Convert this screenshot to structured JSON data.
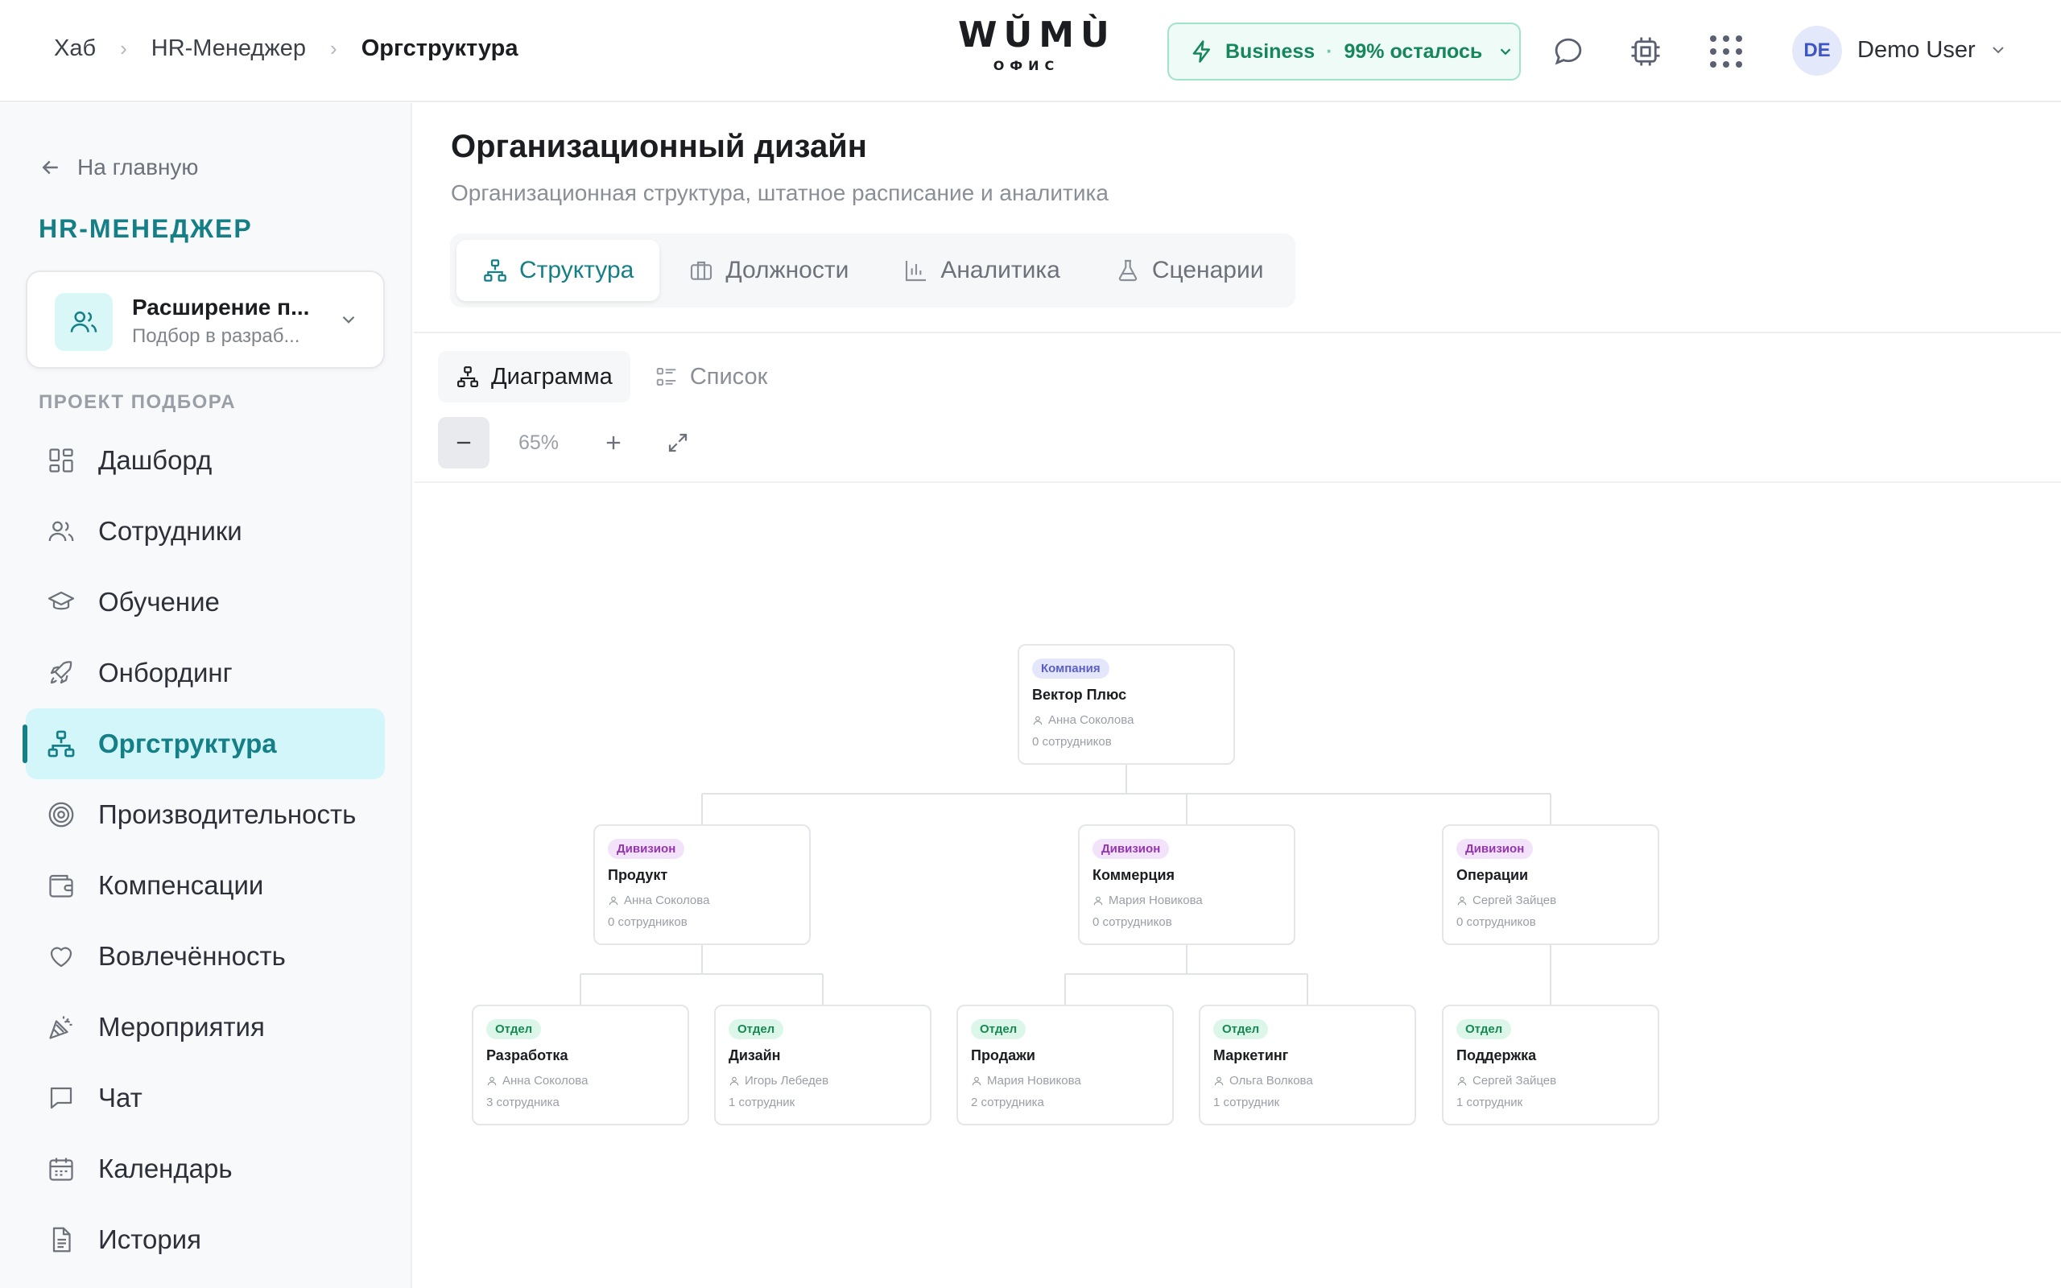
{
  "breadcrumbs": [
    "Хаб",
    "HR-Менеджер",
    "Оргструктура"
  ],
  "logo": {
    "main": "WŬMÙ",
    "sub": "ОФИС"
  },
  "plan": {
    "name": "Business",
    "separator": "·",
    "remaining": "99% осталось"
  },
  "user": {
    "initials": "DE",
    "name": "Demo User"
  },
  "sidebar": {
    "back": "На главную",
    "title": "HR-МЕНЕДЖЕР",
    "project": {
      "title": "Расширение п...",
      "subtitle": "Подбор в разраб..."
    },
    "section": "ПРОЕКТ ПОДБОРА",
    "items": [
      {
        "label": "Дашборд",
        "icon": "dashboard-icon"
      },
      {
        "label": "Сотрудники",
        "icon": "users-icon"
      },
      {
        "label": "Обучение",
        "icon": "graduation-cap-icon"
      },
      {
        "label": "Онбординг",
        "icon": "rocket-icon"
      },
      {
        "label": "Оргструктура",
        "icon": "org-chart-icon",
        "active": true
      },
      {
        "label": "Производительность",
        "icon": "target-icon"
      },
      {
        "label": "Компенсации",
        "icon": "wallet-icon"
      },
      {
        "label": "Вовлечённость",
        "icon": "heart-icon"
      },
      {
        "label": "Мероприятия",
        "icon": "party-icon"
      },
      {
        "label": "Чат",
        "icon": "chat-icon"
      },
      {
        "label": "Календарь",
        "icon": "calendar-icon"
      },
      {
        "label": "История",
        "icon": "document-icon"
      }
    ]
  },
  "main": {
    "title": "Организационный дизайн",
    "subtitle": "Организационная структура, штатное расписание и аналитика",
    "tabs": [
      {
        "label": "Структура",
        "icon": "org-chart-icon",
        "active": true
      },
      {
        "label": "Должности",
        "icon": "briefcase-icon"
      },
      {
        "label": "Аналитика",
        "icon": "bar-chart-icon"
      },
      {
        "label": "Сценарии",
        "icon": "flask-icon"
      }
    ],
    "view_tabs": [
      {
        "label": "Диаграмма",
        "icon": "org-chart-icon",
        "active": true
      },
      {
        "label": "Список",
        "icon": "list-icon"
      }
    ],
    "zoom": "65%"
  },
  "org": {
    "root": {
      "badge": "Компания",
      "name": "Вектор Плюс",
      "lead": "Анна Соколова",
      "count": "0 сотрудников"
    },
    "divisions": [
      {
        "badge": "Дивизион",
        "name": "Продукт",
        "lead": "Анна Соколова",
        "count": "0 сотрудников"
      },
      {
        "badge": "Дивизион",
        "name": "Коммерция",
        "lead": "Мария Новикова",
        "count": "0 сотрудников"
      },
      {
        "badge": "Дивизион",
        "name": "Операции",
        "lead": "Сергей Зайцев",
        "count": "0 сотрудников"
      }
    ],
    "departments": [
      {
        "badge": "Отдел",
        "name": "Разработка",
        "lead": "Анна Соколова",
        "count": "3 сотрудника"
      },
      {
        "badge": "Отдел",
        "name": "Дизайн",
        "lead": "Игорь Лебедев",
        "count": "1 сотрудник"
      },
      {
        "badge": "Отдел",
        "name": "Продажи",
        "lead": "Мария Новикова",
        "count": "2 сотрудника"
      },
      {
        "badge": "Отдел",
        "name": "Маркетинг",
        "lead": "Ольга Волкова",
        "count": "1 сотрудник"
      },
      {
        "badge": "Отдел",
        "name": "Поддержка",
        "lead": "Сергей Зайцев",
        "count": "1 сотрудник"
      }
    ]
  },
  "colors": {
    "accent": "#157f87",
    "plan_green": "#16865c",
    "active_bg": "#d2f6f9"
  }
}
